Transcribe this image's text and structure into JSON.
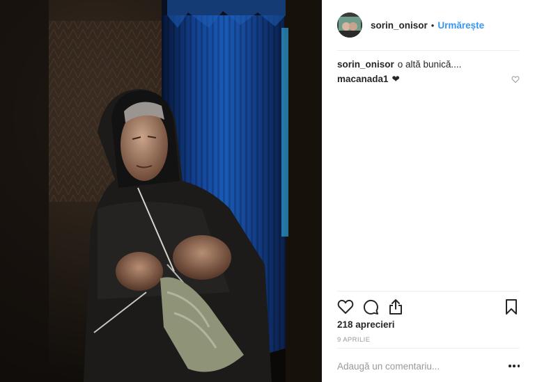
{
  "post": {
    "author": {
      "username": "sorin_onisor",
      "separator": "•",
      "follow_label": "Urmărește"
    },
    "caption": {
      "username": "sorin_onisor",
      "text": "o altă bunică...."
    },
    "comments": [
      {
        "username": "macanada1",
        "text": "❤"
      }
    ],
    "likes_text": "218 aprecieri",
    "date_text": "9 APRILIE",
    "comment_placeholder": "Adaugă un comentariu..."
  },
  "colors": {
    "link": "#3897f0",
    "text": "#262626",
    "muted": "#999999",
    "divider": "#efefef"
  },
  "icons": [
    "heart-icon",
    "comment-icon",
    "share-icon",
    "bookmark-icon",
    "more-options-icon",
    "comment-like-heart-icon"
  ]
}
